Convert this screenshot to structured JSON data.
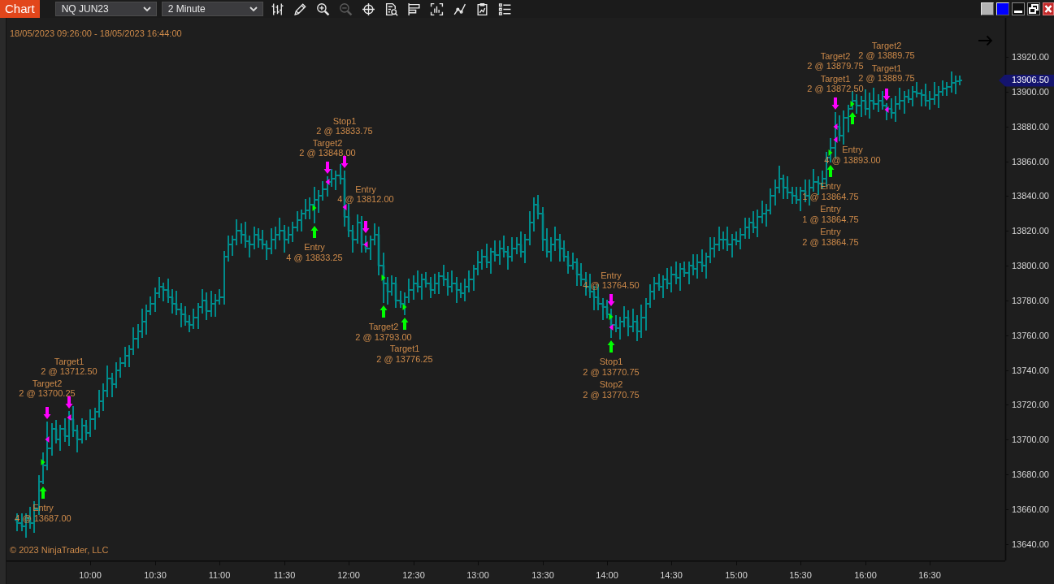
{
  "window": {
    "title": "Chart",
    "buttons": [
      {
        "kind": "swatch",
        "color": "#b4b4b4"
      },
      {
        "kind": "swatch",
        "color": "#0000ff"
      },
      {
        "kind": "minimize"
      },
      {
        "kind": "restore"
      },
      {
        "kind": "close"
      }
    ]
  },
  "toolbar": {
    "instrument": "NQ JUN23",
    "interval": "2 Minute",
    "tools": [
      {
        "kind": "bars",
        "disabled": false
      },
      {
        "kind": "pencil",
        "disabled": false
      },
      {
        "kind": "zoom-in",
        "disabled": false
      },
      {
        "kind": "zoom-out",
        "disabled": true
      },
      {
        "kind": "crosshair",
        "disabled": false
      },
      {
        "kind": "document-search",
        "disabled": false
      },
      {
        "kind": "flag",
        "disabled": false
      },
      {
        "kind": "bar-chart",
        "disabled": false
      },
      {
        "kind": "line-chart",
        "disabled": false
      },
      {
        "kind": "clipboard",
        "disabled": false
      },
      {
        "kind": "list",
        "disabled": false
      }
    ]
  },
  "chart": {
    "date_range": "18/05/2023 09:26:00 - 18/05/2023 16:44:00",
    "copyright": "© 2023 NinjaTrader, LLC",
    "last_price": "13906.50",
    "chart_data": {
      "type": "candlestick",
      "color": "#008b8b",
      "xlim": [
        "2023-05-18T09:21",
        "2023-05-18T17:05"
      ],
      "ylim": [
        13630.5,
        13942.5
      ],
      "xticks": [
        {
          "value": "2023-05-18T10:00",
          "label": "10:00"
        },
        {
          "value": "2023-05-18T10:30",
          "label": "10:30"
        },
        {
          "value": "2023-05-18T11:00",
          "label": "11:00"
        },
        {
          "value": "2023-05-18T11:30",
          "label": "11:30"
        },
        {
          "value": "2023-05-18T12:00",
          "label": "12:00"
        },
        {
          "value": "2023-05-18T12:30",
          "label": "12:30"
        },
        {
          "value": "2023-05-18T13:00",
          "label": "13:00"
        },
        {
          "value": "2023-05-18T13:30",
          "label": "13:30"
        },
        {
          "value": "2023-05-18T14:00",
          "label": "14:00"
        },
        {
          "value": "2023-05-18T14:30",
          "label": "14:30"
        },
        {
          "value": "2023-05-18T15:00",
          "label": "15:00"
        },
        {
          "value": "2023-05-18T15:30",
          "label": "15:30"
        },
        {
          "value": "2023-05-18T16:00",
          "label": "16:00"
        },
        {
          "value": "2023-05-18T16:30",
          "label": "16:30"
        }
      ],
      "yticks": [
        {
          "value": 13920,
          "label": "13920.00"
        },
        {
          "value": 13900,
          "label": "13900.00"
        },
        {
          "value": 13880,
          "label": "13880.00"
        },
        {
          "value": 13860,
          "label": "13860.00"
        },
        {
          "value": 13840,
          "label": "13840.00"
        },
        {
          "value": 13820,
          "label": "13820.00"
        },
        {
          "value": 13800,
          "label": "13800.00"
        },
        {
          "value": 13780,
          "label": "13780.00"
        },
        {
          "value": 13760,
          "label": "13760.00"
        },
        {
          "value": 13740,
          "label": "13740.00"
        },
        {
          "value": 13720,
          "label": "13720.00"
        },
        {
          "value": 13700,
          "label": "13700.00"
        },
        {
          "value": 13680,
          "label": "13680.00"
        },
        {
          "value": 13660,
          "label": "13660.00"
        },
        {
          "value": 13640,
          "label": "13640.00"
        }
      ],
      "x": [
        "2023-05-18T09:26",
        "2023-05-18T09:28",
        "2023-05-18T09:30",
        "2023-05-18T09:32",
        "2023-05-18T09:34",
        "2023-05-18T09:36",
        "2023-05-18T09:38",
        "2023-05-18T09:40",
        "2023-05-18T09:42",
        "2023-05-18T09:44",
        "2023-05-18T09:46",
        "2023-05-18T09:48",
        "2023-05-18T09:50",
        "2023-05-18T09:52",
        "2023-05-18T09:54",
        "2023-05-18T09:56",
        "2023-05-18T09:58",
        "2023-05-18T10:00",
        "2023-05-18T10:02",
        "2023-05-18T10:04",
        "2023-05-18T10:06",
        "2023-05-18T10:08",
        "2023-05-18T10:10",
        "2023-05-18T10:12",
        "2023-05-18T10:14",
        "2023-05-18T10:16",
        "2023-05-18T10:18",
        "2023-05-18T10:20",
        "2023-05-18T10:22",
        "2023-05-18T10:24",
        "2023-05-18T10:26",
        "2023-05-18T10:28",
        "2023-05-18T10:30",
        "2023-05-18T10:32",
        "2023-05-18T10:34",
        "2023-05-18T10:36",
        "2023-05-18T10:38",
        "2023-05-18T10:40",
        "2023-05-18T10:42",
        "2023-05-18T10:44",
        "2023-05-18T10:46",
        "2023-05-18T10:48",
        "2023-05-18T10:50",
        "2023-05-18T10:52",
        "2023-05-18T10:54",
        "2023-05-18T10:56",
        "2023-05-18T10:58",
        "2023-05-18T11:00",
        "2023-05-18T11:02",
        "2023-05-18T11:04",
        "2023-05-18T11:06",
        "2023-05-18T11:08",
        "2023-05-18T11:10",
        "2023-05-18T11:12",
        "2023-05-18T11:14",
        "2023-05-18T11:16",
        "2023-05-18T11:18",
        "2023-05-18T11:20",
        "2023-05-18T11:22",
        "2023-05-18T11:24",
        "2023-05-18T11:26",
        "2023-05-18T11:28",
        "2023-05-18T11:30",
        "2023-05-18T11:32",
        "2023-05-18T11:34",
        "2023-05-18T11:36",
        "2023-05-18T11:38",
        "2023-05-18T11:40",
        "2023-05-18T11:42",
        "2023-05-18T11:44",
        "2023-05-18T11:46",
        "2023-05-18T11:48",
        "2023-05-18T11:50",
        "2023-05-18T11:52",
        "2023-05-18T11:54",
        "2023-05-18T11:56",
        "2023-05-18T11:58",
        "2023-05-18T12:00",
        "2023-05-18T12:02",
        "2023-05-18T12:04",
        "2023-05-18T12:06",
        "2023-05-18T12:08",
        "2023-05-18T12:10",
        "2023-05-18T12:12",
        "2023-05-18T12:14",
        "2023-05-18T12:16",
        "2023-05-18T12:18",
        "2023-05-18T12:20",
        "2023-05-18T12:22",
        "2023-05-18T12:24",
        "2023-05-18T12:26",
        "2023-05-18T12:28",
        "2023-05-18T12:30",
        "2023-05-18T12:32",
        "2023-05-18T12:34",
        "2023-05-18T12:36",
        "2023-05-18T12:38",
        "2023-05-18T12:40",
        "2023-05-18T12:42",
        "2023-05-18T12:44",
        "2023-05-18T12:46",
        "2023-05-18T12:48",
        "2023-05-18T12:50",
        "2023-05-18T12:52",
        "2023-05-18T12:54",
        "2023-05-18T12:56",
        "2023-05-18T12:58",
        "2023-05-18T13:00",
        "2023-05-18T13:02",
        "2023-05-18T13:04",
        "2023-05-18T13:06",
        "2023-05-18T13:08",
        "2023-05-18T13:10",
        "2023-05-18T13:12",
        "2023-05-18T13:14",
        "2023-05-18T13:16",
        "2023-05-18T13:18",
        "2023-05-18T13:20",
        "2023-05-18T13:22",
        "2023-05-18T13:24",
        "2023-05-18T13:26",
        "2023-05-18T13:28",
        "2023-05-18T13:30",
        "2023-05-18T13:32",
        "2023-05-18T13:34",
        "2023-05-18T13:36",
        "2023-05-18T13:38",
        "2023-05-18T13:40",
        "2023-05-18T13:42",
        "2023-05-18T13:44",
        "2023-05-18T13:46",
        "2023-05-18T13:48",
        "2023-05-18T13:50",
        "2023-05-18T13:52",
        "2023-05-18T13:54",
        "2023-05-18T13:56",
        "2023-05-18T13:58",
        "2023-05-18T14:00",
        "2023-05-18T14:02",
        "2023-05-18T14:04",
        "2023-05-18T14:06",
        "2023-05-18T14:08",
        "2023-05-18T14:10",
        "2023-05-18T14:12",
        "2023-05-18T14:14",
        "2023-05-18T14:16",
        "2023-05-18T14:18",
        "2023-05-18T14:20",
        "2023-05-18T14:22",
        "2023-05-18T14:24",
        "2023-05-18T14:26",
        "2023-05-18T14:28",
        "2023-05-18T14:30",
        "2023-05-18T14:32",
        "2023-05-18T14:34",
        "2023-05-18T14:36",
        "2023-05-18T14:38",
        "2023-05-18T14:40",
        "2023-05-18T14:42",
        "2023-05-18T14:44",
        "2023-05-18T14:46",
        "2023-05-18T14:48",
        "2023-05-18T14:50",
        "2023-05-18T14:52",
        "2023-05-18T14:54",
        "2023-05-18T14:56",
        "2023-05-18T14:58",
        "2023-05-18T15:00",
        "2023-05-18T15:02",
        "2023-05-18T15:04",
        "2023-05-18T15:06",
        "2023-05-18T15:08",
        "2023-05-18T15:10",
        "2023-05-18T15:12",
        "2023-05-18T15:14",
        "2023-05-18T15:16",
        "2023-05-18T15:18",
        "2023-05-18T15:20",
        "2023-05-18T15:22",
        "2023-05-18T15:24",
        "2023-05-18T15:26",
        "2023-05-18T15:28",
        "2023-05-18T15:30",
        "2023-05-18T15:32",
        "2023-05-18T15:34",
        "2023-05-18T15:36",
        "2023-05-18T15:38",
        "2023-05-18T15:40",
        "2023-05-18T15:42",
        "2023-05-18T15:44",
        "2023-05-18T15:46",
        "2023-05-18T15:48",
        "2023-05-18T15:50",
        "2023-05-18T15:52",
        "2023-05-18T15:54",
        "2023-05-18T15:56",
        "2023-05-18T15:58",
        "2023-05-18T16:00",
        "2023-05-18T16:02",
        "2023-05-18T16:04",
        "2023-05-18T16:06",
        "2023-05-18T16:08",
        "2023-05-18T16:10",
        "2023-05-18T16:12",
        "2023-05-18T16:14",
        "2023-05-18T16:16",
        "2023-05-18T16:18",
        "2023-05-18T16:20",
        "2023-05-18T16:22",
        "2023-05-18T16:24",
        "2023-05-18T16:26",
        "2023-05-18T16:28",
        "2023-05-18T16:30",
        "2023-05-18T16:32",
        "2023-05-18T16:34",
        "2023-05-18T16:36",
        "2023-05-18T16:38",
        "2023-05-18T16:40",
        "2023-05-18T16:42",
        "2023-05-18T16:44"
      ],
      "ohlc": [
        [
          13654,
          13657,
          13648,
          13652
        ],
        [
          13652,
          13657,
          13648,
          13650
        ],
        [
          13650,
          13657,
          13644,
          13655
        ],
        [
          13655,
          13661,
          13649,
          13652
        ],
        [
          13652,
          13664,
          13647,
          13660
        ],
        [
          13660,
          13679,
          13657,
          13676
        ],
        [
          13676,
          13692,
          13675,
          13685
        ],
        [
          13685,
          13710,
          13683,
          13695
        ],
        [
          13695,
          13709,
          13691,
          13706
        ],
        [
          13706,
          13711,
          13698,
          13700
        ],
        [
          13700,
          13708,
          13694,
          13706
        ],
        [
          13706,
          13712,
          13699,
          13702
        ],
        [
          13702,
          13716,
          13697,
          13712
        ],
        [
          13712,
          13719,
          13702,
          13705
        ],
        [
          13705,
          13708,
          13693,
          13700
        ],
        [
          13700,
          13712,
          13698,
          13708
        ],
        [
          13708,
          13711,
          13700,
          13704
        ],
        [
          13704,
          13717,
          13702,
          13712
        ],
        [
          13712,
          13718,
          13706,
          13716
        ],
        [
          13716,
          13728,
          13713,
          13722
        ],
        [
          13722,
          13732,
          13717,
          13728
        ],
        [
          13728,
          13742,
          13725,
          13735
        ],
        [
          13735,
          13738,
          13725,
          13732
        ],
        [
          13732,
          13744,
          13730,
          13740
        ],
        [
          13740,
          13747,
          13736,
          13744
        ],
        [
          13744,
          13753,
          13742,
          13748
        ],
        [
          13748,
          13754,
          13742,
          13752
        ],
        [
          13752,
          13764,
          13749,
          13758
        ],
        [
          13758,
          13766,
          13753,
          13762
        ],
        [
          13762,
          13775,
          13759,
          13768
        ],
        [
          13768,
          13777,
          13761,
          13774
        ],
        [
          13774,
          13782,
          13772,
          13778
        ],
        [
          13778,
          13787,
          13774,
          13784
        ],
        [
          13784,
          13793,
          13782,
          13788
        ],
        [
          13788,
          13790,
          13780,
          13786
        ],
        [
          13786,
          13792,
          13779,
          13782
        ],
        [
          13782,
          13786,
          13773,
          13778
        ],
        [
          13778,
          13785,
          13772,
          13775
        ],
        [
          13775,
          13778,
          13765,
          13772
        ],
        [
          13772,
          13776,
          13766,
          13768
        ],
        [
          13768,
          13771,
          13762,
          13766
        ],
        [
          13766,
          13775,
          13764,
          13770
        ],
        [
          13770,
          13778,
          13764,
          13776
        ],
        [
          13776,
          13786,
          13773,
          13780
        ],
        [
          13780,
          13784,
          13769,
          13774
        ],
        [
          13774,
          13785,
          13771,
          13778
        ],
        [
          13778,
          13783,
          13771,
          13780
        ],
        [
          13780,
          13786,
          13778,
          13782
        ],
        [
          13782,
          13808,
          13778,
          13805
        ],
        [
          13805,
          13817,
          13803,
          13812
        ],
        [
          13812,
          13817,
          13806,
          13815
        ],
        [
          13815,
          13826,
          13812,
          13820
        ],
        [
          13820,
          13824,
          13813,
          13818
        ],
        [
          13818,
          13825,
          13811,
          13814
        ],
        [
          13814,
          13817,
          13805,
          13812
        ],
        [
          13812,
          13822,
          13810,
          13818
        ],
        [
          13818,
          13821,
          13811,
          13815
        ],
        [
          13815,
          13820,
          13810,
          13812
        ],
        [
          13812,
          13814,
          13804,
          13810
        ],
        [
          13810,
          13821,
          13807,
          13815
        ],
        [
          13815,
          13822,
          13810,
          13818
        ],
        [
          13818,
          13827,
          13815,
          13820
        ],
        [
          13820,
          13823,
          13808,
          13815
        ],
        [
          13815,
          13822,
          13813,
          13818
        ],
        [
          13818,
          13825,
          13814,
          13822
        ],
        [
          13822,
          13831,
          13820,
          13826
        ],
        [
          13826,
          13832,
          13820,
          13830
        ],
        [
          13830,
          13838,
          13827,
          13832
        ],
        [
          13832,
          13839,
          13827,
          13835
        ],
        [
          13835,
          13845,
          13825,
          13838
        ],
        [
          13838,
          13843,
          13831,
          13840
        ],
        [
          13840,
          13848,
          13838,
          13844
        ],
        [
          13844,
          13851,
          13840,
          13848
        ],
        [
          13848,
          13855,
          13846,
          13850
        ],
        [
          13850,
          13854,
          13844,
          13852
        ],
        [
          13852,
          13858,
          13847,
          13850
        ],
        [
          13850,
          13854,
          13823,
          13828
        ],
        [
          13828,
          13835,
          13817,
          13820
        ],
        [
          13820,
          13823,
          13808,
          13815
        ],
        [
          13815,
          13829,
          13813,
          13825
        ],
        [
          13825,
          13828,
          13808,
          13812
        ],
        [
          13812,
          13817,
          13808,
          13810
        ],
        [
          13810,
          13817,
          13804,
          13815
        ],
        [
          13815,
          13824,
          13812,
          13818
        ],
        [
          13818,
          13822,
          13795,
          13800
        ],
        [
          13800,
          13807,
          13779,
          13790
        ],
        [
          13790,
          13793,
          13778,
          13785
        ],
        [
          13785,
          13794,
          13783,
          13790
        ],
        [
          13790,
          13793,
          13776,
          13780
        ],
        [
          13780,
          13785,
          13776,
          13778
        ],
        [
          13778,
          13784,
          13772,
          13782
        ],
        [
          13782,
          13792,
          13779,
          13786
        ],
        [
          13786,
          13794,
          13781,
          13790
        ],
        [
          13790,
          13797,
          13785,
          13788
        ],
        [
          13788,
          13795,
          13781,
          13792
        ],
        [
          13792,
          13796,
          13788,
          13790
        ],
        [
          13790,
          13793,
          13782,
          13786
        ],
        [
          13786,
          13795,
          13784,
          13790
        ],
        [
          13790,
          13796,
          13784,
          13794
        ],
        [
          13794,
          13800,
          13789,
          13792
        ],
        [
          13792,
          13796,
          13783,
          13788
        ],
        [
          13788,
          13797,
          13785,
          13790
        ],
        [
          13790,
          13793,
          13779,
          13786
        ],
        [
          13786,
          13790,
          13782,
          13784
        ],
        [
          13784,
          13792,
          13780,
          13788
        ],
        [
          13788,
          13797,
          13785,
          13792
        ],
        [
          13792,
          13800,
          13786,
          13798
        ],
        [
          13798,
          13808,
          13795,
          13802
        ],
        [
          13802,
          13809,
          13798,
          13805
        ],
        [
          13805,
          13812,
          13799,
          13802
        ],
        [
          13802,
          13810,
          13796,
          13808
        ],
        [
          13808,
          13814,
          13803,
          13806
        ],
        [
          13806,
          13814,
          13801,
          13810
        ],
        [
          13810,
          13817,
          13805,
          13808
        ],
        [
          13808,
          13811,
          13798,
          13805
        ],
        [
          13805,
          13816,
          13803,
          13810
        ],
        [
          13810,
          13816,
          13807,
          13812
        ],
        [
          13812,
          13819,
          13805,
          13808
        ],
        [
          13808,
          13818,
          13802,
          13815
        ],
        [
          13815,
          13831,
          13812,
          13825
        ],
        [
          13825,
          13839,
          13820,
          13835
        ],
        [
          13835,
          13840,
          13827,
          13830
        ],
        [
          13830,
          13833,
          13809,
          13815
        ],
        [
          13815,
          13821,
          13805,
          13808
        ],
        [
          13808,
          13816,
          13803,
          13812
        ],
        [
          13812,
          13822,
          13809,
          13815
        ],
        [
          13815,
          13818,
          13803,
          13810
        ],
        [
          13810,
          13814,
          13803,
          13805
        ],
        [
          13805,
          13808,
          13796,
          13800
        ],
        [
          13800,
          13807,
          13798,
          13802
        ],
        [
          13802,
          13804,
          13789,
          13795
        ],
        [
          13795,
          13801,
          13789,
          13792
        ],
        [
          13792,
          13796,
          13783,
          13788
        ],
        [
          13788,
          13795,
          13782,
          13785
        ],
        [
          13785,
          13788,
          13775,
          13782
        ],
        [
          13782,
          13789,
          13775,
          13778
        ],
        [
          13778,
          13781,
          13769,
          13776
        ],
        [
          13776,
          13780,
          13770,
          13772
        ],
        [
          13772,
          13775,
          13759,
          13766
        ],
        [
          13766,
          13771,
          13762,
          13764
        ],
        [
          13764,
          13770,
          13758,
          13768
        ],
        [
          13768,
          13776,
          13765,
          13770
        ],
        [
          13770,
          13774,
          13760,
          13765
        ],
        [
          13765,
          13775,
          13762,
          13768
        ],
        [
          13768,
          13771,
          13757,
          13762
        ],
        [
          13762,
          13777,
          13759,
          13770
        ],
        [
          13770,
          13781,
          13763,
          13778
        ],
        [
          13778,
          13789,
          13776,
          13785
        ],
        [
          13785,
          13793,
          13781,
          13790
        ],
        [
          13790,
          13795,
          13786,
          13788
        ],
        [
          13788,
          13794,
          13782,
          13792
        ],
        [
          13792,
          13798,
          13787,
          13790
        ],
        [
          13790,
          13799,
          13785,
          13795
        ],
        [
          13795,
          13802,
          13790,
          13793
        ],
        [
          13793,
          13801,
          13786,
          13798
        ],
        [
          13798,
          13802,
          13794,
          13796
        ],
        [
          13796,
          13802,
          13790,
          13800
        ],
        [
          13800,
          13806,
          13795,
          13798
        ],
        [
          13798,
          13806,
          13793,
          13802
        ],
        [
          13802,
          13809,
          13797,
          13800
        ],
        [
          13800,
          13807,
          13793,
          13805
        ],
        [
          13805,
          13816,
          13802,
          13810
        ],
        [
          13810,
          13816,
          13805,
          13812
        ],
        [
          13812,
          13822,
          13809,
          13815
        ],
        [
          13815,
          13819,
          13810,
          13815
        ],
        [
          13815,
          13822,
          13809,
          13812
        ],
        [
          13812,
          13818,
          13805,
          13815
        ],
        [
          13815,
          13819,
          13812,
          13814
        ],
        [
          13814,
          13821,
          13810,
          13818
        ],
        [
          13818,
          13827,
          13816,
          13822
        ],
        [
          13822,
          13827,
          13816,
          13825
        ],
        [
          13825,
          13831,
          13819,
          13822
        ],
        [
          13822,
          13832,
          13817,
          13828
        ],
        [
          13828,
          13837,
          13825,
          13830
        ],
        [
          13830,
          13835,
          13823,
          13832
        ],
        [
          13832,
          13844,
          13830,
          13840
        ],
        [
          13840,
          13849,
          13835,
          13845
        ],
        [
          13845,
          13857,
          13842,
          13850
        ],
        [
          13850,
          13852,
          13839,
          13845
        ],
        [
          13845,
          13851,
          13839,
          13842
        ],
        [
          13842,
          13845,
          13836,
          13840
        ],
        [
          13840,
          13845,
          13836,
          13838
        ],
        [
          13838,
          13845,
          13832,
          13843
        ],
        [
          13843,
          13849,
          13837,
          13840
        ],
        [
          13840,
          13849,
          13835,
          13845
        ],
        [
          13845,
          13855,
          13843,
          13848
        ],
        [
          13848,
          13851,
          13841,
          13847
        ],
        [
          13847,
          13854,
          13845,
          13850
        ],
        [
          13850,
          13865,
          13846,
          13862
        ],
        [
          13862,
          13873,
          13860,
          13868
        ],
        [
          13868,
          13888,
          13862,
          13880
        ],
        [
          13880,
          13886,
          13872,
          13875
        ],
        [
          13875,
          13889,
          13870,
          13885
        ],
        [
          13885,
          13892,
          13877,
          13890
        ],
        [
          13890,
          13900,
          13890,
          13895
        ],
        [
          13895,
          13898,
          13888,
          13892
        ],
        [
          13892,
          13897,
          13886,
          13895
        ],
        [
          13895,
          13901,
          13887,
          13890
        ],
        [
          13890,
          13899,
          13885,
          13895
        ],
        [
          13895,
          13902,
          13890,
          13893
        ],
        [
          13893,
          13898,
          13889,
          13895
        ],
        [
          13895,
          13900,
          13890,
          13892
        ],
        [
          13892,
          13893,
          13884,
          13890
        ],
        [
          13890,
          13896,
          13885,
          13888
        ],
        [
          13888,
          13897,
          13883,
          13893
        ],
        [
          13893,
          13902,
          13890,
          13895
        ],
        [
          13895,
          13900,
          13888,
          13897
        ],
        [
          13897,
          13901,
          13894,
          13896
        ],
        [
          13896,
          13903,
          13892,
          13900
        ],
        [
          13900,
          13905,
          13897,
          13899
        ],
        [
          13899,
          13901,
          13892,
          13898
        ],
        [
          13898,
          13904,
          13892,
          13895
        ],
        [
          13895,
          13900,
          13890,
          13896
        ],
        [
          13896,
          13905,
          13893,
          13898
        ],
        [
          13898,
          13903,
          13891,
          13900
        ],
        [
          13900,
          13906,
          13898,
          13902
        ],
        [
          13902,
          13905,
          13898,
          13903
        ],
        [
          13903,
          13911,
          13900,
          13905
        ],
        [
          13905,
          13909,
          13899,
          13906
        ],
        [
          13906,
          13909,
          13904,
          13906.5
        ]
      ],
      "series": [
        {
          "type": "scatter",
          "marker": "triangle",
          "color": "#00ff00",
          "x": [
            "2023-05-18T09:38",
            "2023-05-18T11:44",
            "2023-05-18T12:16",
            "2023-05-18T12:26",
            "2023-05-18T14:02",
            "2023-05-18T15:44",
            "2023-05-18T15:54"
          ],
          "values": [
            13687,
            13833.25,
            13793,
            13776.25,
            13770.75,
            13864.75,
            13893
          ],
          "value_labels": [
            [
              "Entry",
              "4 @ 13687.00"
            ],
            [
              "Entry",
              "4 @ 13833.25"
            ],
            [
              "Target2",
              "2 @ 13793.00"
            ],
            [
              "Target1",
              "2 @ 13776.25"
            ],
            [
              "Stop1",
              "2 @ 13770.75",
              "Stop2",
              "2 @ 13770.75"
            ],
            [
              "Entry",
              "1 @ 13864.75",
              "Entry",
              "1 @ 13864.75",
              "Entry",
              "2 @ 13864.75"
            ],
            [
              "Entry",
              "4 @ 13893.00"
            ]
          ]
        },
        {
          "type": "scatter",
          "marker": "triangle",
          "color": "#ff00ff",
          "x": [
            "2023-05-18T09:40",
            "2023-05-18T09:50",
            "2023-05-18T11:50",
            "2023-05-18T11:58",
            "2023-05-18T12:08",
            "2023-05-18T14:02",
            "2023-05-18T15:46",
            "2023-05-18T15:46",
            "2023-05-18T16:10"
          ],
          "values": [
            13700.25,
            13712.5,
            13848,
            13833.75,
            13812,
            13764.5,
            13879.75,
            13872.5,
            13889.75
          ],
          "value_labels": [
            [
              "Target2",
              "2 @ 13700.25"
            ],
            [
              "Target1",
              "2 @ 13712.50"
            ],
            [
              "Target2",
              "2 @ 13848.00"
            ],
            [
              "Stop1",
              "2 @ 13833.75"
            ],
            [
              "Entry",
              "4 @ 13812.00"
            ],
            [
              "Entry",
              "4 @ 13764.50"
            ],
            [
              "Target2",
              "2 @ 13879.75"
            ],
            [
              "Target1",
              "2 @ 13872.50"
            ],
            [
              "Target2",
              "2 @ 13889.75",
              "Target1",
              "2 @ 13889.75"
            ]
          ]
        }
      ]
    },
    "series_markers": [
      {
        "kind": "arrow-up"
      },
      {
        "kind": "arrow-down"
      }
    ]
  }
}
